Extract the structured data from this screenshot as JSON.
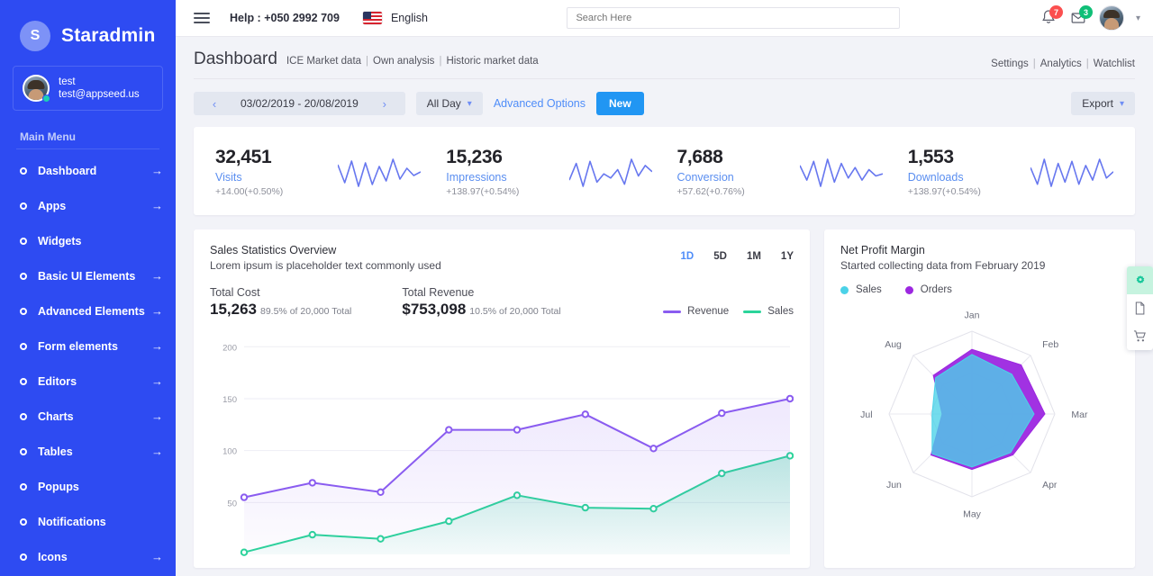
{
  "sidebar": {
    "brand": {
      "logo_letter": "S",
      "name": "Staradmin"
    },
    "profile": {
      "name": "test",
      "email": "test@appseed.us",
      "status": "online"
    },
    "menu_title": "Main Menu",
    "items": [
      {
        "label": "Dashboard",
        "arrow": true
      },
      {
        "label": "Apps",
        "arrow": true
      },
      {
        "label": "Widgets",
        "arrow": false
      },
      {
        "label": "Basic UI Elements",
        "arrow": true
      },
      {
        "label": "Advanced Elements",
        "arrow": true
      },
      {
        "label": "Form elements",
        "arrow": true
      },
      {
        "label": "Editors",
        "arrow": true
      },
      {
        "label": "Charts",
        "arrow": true
      },
      {
        "label": "Tables",
        "arrow": true
      },
      {
        "label": "Popups",
        "arrow": false
      },
      {
        "label": "Notifications",
        "arrow": false
      },
      {
        "label": "Icons",
        "arrow": true
      }
    ]
  },
  "navbar": {
    "menu_icon": "hamburger-icon",
    "help": "Help : +050 2992 709",
    "language": "English",
    "flag": "us-flag-icon",
    "search_placeholder": "Search Here",
    "search_value": "",
    "notifications_count": "7",
    "messages_count": "3"
  },
  "page": {
    "title": "Dashboard",
    "breadcrumb": [
      "ICE Market data",
      "Own analysis",
      "Historic market data"
    ],
    "links": [
      "Settings",
      "Analytics",
      "Watchlist"
    ],
    "separator": "|"
  },
  "toolbar": {
    "date_range": "03/02/2019 - 20/08/2019",
    "prev_icon": "chevron-left-icon",
    "next_icon": "chevron-right-icon",
    "all_day": "All Day",
    "advanced_options": "Advanced Options",
    "new_button": "New",
    "export": "Export"
  },
  "stats": [
    {
      "value": "32,451",
      "label": "Visits",
      "delta": "+14.00(+0.50%)",
      "spark": [
        14,
        4,
        16,
        2,
        15,
        3,
        13,
        5,
        17,
        6,
        12,
        8,
        10
      ]
    },
    {
      "value": "15,236",
      "label": "Impressions",
      "delta": "+138.97(+0.54%)",
      "spark": [
        6,
        14,
        3,
        15,
        5,
        9,
        7,
        11,
        4,
        16,
        8,
        13,
        10
      ]
    },
    {
      "value": "7,688",
      "label": "Conversion",
      "delta": "+57.62(+0.76%)",
      "spark": [
        13,
        6,
        15,
        3,
        16,
        5,
        14,
        7,
        12,
        6,
        11,
        8,
        9
      ]
    },
    {
      "value": "1,553",
      "label": "Downloads",
      "delta": "+138.97(+0.54%)",
      "spark": [
        12,
        4,
        16,
        3,
        14,
        5,
        15,
        4,
        13,
        6,
        16,
        7,
        10
      ]
    }
  ],
  "sales_card": {
    "title": "Sales Statistics Overview",
    "subtitle": "Lorem ipsum is placeholder text commonly used",
    "ranges": [
      "1D",
      "5D",
      "1M",
      "1Y"
    ],
    "active_range": "1D",
    "total_cost_label": "Total Cost",
    "total_cost_value": "15,263",
    "total_cost_note": "89.5% of 20,000 Total",
    "total_revenue_label": "Total Revenue",
    "total_revenue_value": "$753,098",
    "total_revenue_note": "10.5% of 20,000 Total",
    "legend": [
      {
        "name": "Revenue",
        "color": "#8a5cf0"
      },
      {
        "name": "Sales",
        "color": "#2bd49a"
      }
    ]
  },
  "profit_card": {
    "title": "Net Profit Margin",
    "subtitle": "Started collecting data from February 2019",
    "legend": [
      {
        "name": "Sales",
        "color": "#4bd2e8"
      },
      {
        "name": "Orders",
        "color": "#9c27e0"
      }
    ]
  },
  "float_actions": [
    {
      "icon": "gear-icon",
      "active": true
    },
    {
      "icon": "document-icon",
      "active": false
    },
    {
      "icon": "cart-icon",
      "active": false
    }
  ],
  "chart_data": [
    {
      "type": "area",
      "title": "Sales Statistics Overview",
      "xlabel": "",
      "ylabel": "",
      "ylim": [
        0,
        215
      ],
      "yticks": [
        50,
        100,
        150,
        200
      ],
      "grid": true,
      "legend_position": "top-right",
      "x": [
        1,
        2,
        3,
        4,
        5,
        6,
        7,
        8,
        9
      ],
      "series": [
        {
          "name": "Revenue",
          "color": "#8a5cf0",
          "values": [
            55,
            69,
            60,
            120,
            120,
            135,
            102,
            136,
            150
          ]
        },
        {
          "name": "Sales",
          "color": "#2bd49a",
          "values": [
            2,
            19,
            15,
            32,
            57,
            45,
            44,
            78,
            95
          ]
        }
      ]
    },
    {
      "type": "radar",
      "title": "Net Profit Margin",
      "categories": [
        "Jan",
        "Feb",
        "Mar",
        "Apr",
        "May",
        "Jun",
        "Jul",
        "Aug"
      ],
      "rmax": 100,
      "grid": true,
      "legend_position": "top-left",
      "series": [
        {
          "name": "Sales",
          "color": "#4bd2e8",
          "values": [
            72,
            68,
            75,
            66,
            64,
            68,
            48,
            62
          ]
        },
        {
          "name": "Orders",
          "color": "#9c27e0",
          "values": [
            78,
            84,
            88,
            70,
            67,
            70,
            36,
            66
          ]
        }
      ]
    }
  ]
}
